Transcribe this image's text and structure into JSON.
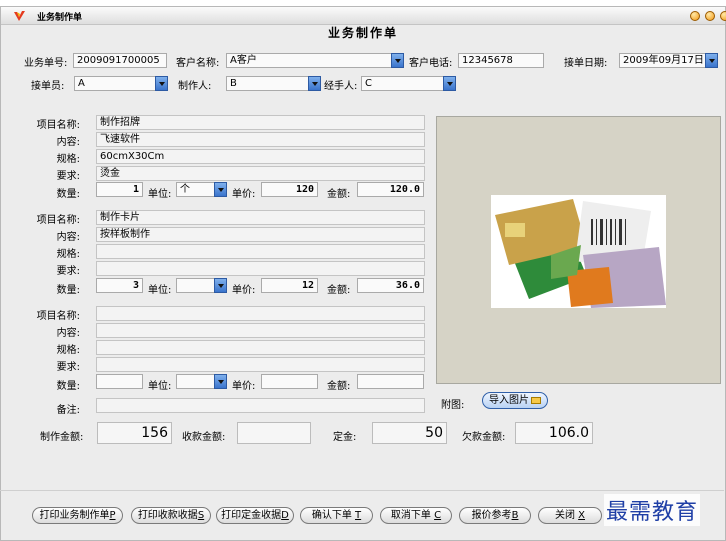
{
  "window": {
    "title": "业务制作单"
  },
  "form_title": "业务制作单",
  "header": {
    "order_no_label": "业务单号:",
    "order_no": "2009091700005",
    "customer_label": "客户名称:",
    "customer": "A客户",
    "phone_label": "客户电话:",
    "phone": "12345678",
    "date_label": "接单日期:",
    "date": "2009年09月17日",
    "receiver_label": "接单员:",
    "receiver": "A",
    "maker_label": "制作人:",
    "maker": "B",
    "handler_label": "经手人:",
    "handler": "C"
  },
  "labels": {
    "item_name": "项目名称:",
    "content": "内容:",
    "spec": "规格:",
    "req": "要求:",
    "qty": "数量:",
    "unit": "单位:",
    "price": "单价:",
    "amount": "金额:",
    "remark": "备注:",
    "attach": "附图:"
  },
  "items": [
    {
      "name": "制作招牌",
      "content": "飞速软件",
      "spec": "60cmX30Cm",
      "req": "烫金",
      "qty": "1",
      "unit": "个",
      "price": "120",
      "amount": "120.0"
    },
    {
      "name": "制作卡片",
      "content": "按样板制作",
      "spec": "",
      "req": "",
      "qty": "3",
      "unit": "",
      "price": "12",
      "amount": "36.0"
    },
    {
      "name": "",
      "content": "",
      "spec": "",
      "req": "",
      "qty": "",
      "unit": "",
      "price": "",
      "amount": ""
    }
  ],
  "remark": "",
  "totals": {
    "make_label": "制作金额:",
    "make": "156",
    "received_label": "收款金额:",
    "received": "",
    "deposit_label": "定金:",
    "deposit": "50",
    "owed_label": "欠款金额:",
    "owed": "106.0"
  },
  "import_button": "导入图片",
  "buttons": {
    "print_order": "打印业务制作单",
    "print_order_key": "P",
    "print_receipt": "打印收款收据",
    "print_receipt_key": "S",
    "print_deposit": "打印定金收据",
    "print_deposit_key": "D",
    "confirm": "确认下单",
    "confirm_key": "T",
    "cancel": "取消下单",
    "cancel_key": "C",
    "quote": "报价参考",
    "quote_key": "B",
    "close": "关闭",
    "close_key": "X"
  },
  "watermark": "最需教育",
  "colors": {
    "dropdown": "#3a74cc",
    "watermark": "#1f3fa6",
    "photo_bg": "#d6d3c6"
  }
}
